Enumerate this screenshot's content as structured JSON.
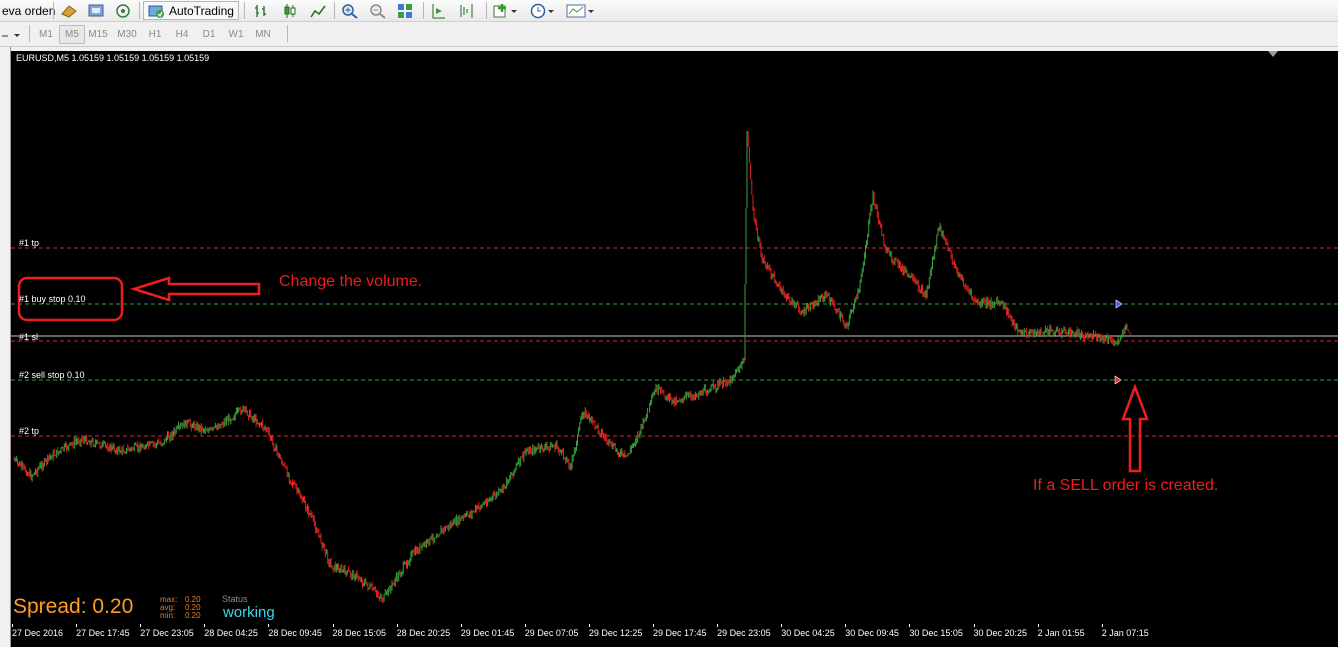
{
  "toolbar": {
    "new_order_label": "eva orden",
    "autotrading_label": "AutoTrading"
  },
  "timeframes": [
    "M1",
    "M5",
    "M15",
    "M30",
    "H1",
    "H4",
    "D1",
    "W1",
    "MN"
  ],
  "active_timeframe": "M5",
  "chart": {
    "symbol_header": "EURUSD,M5  1.05159 1.05159 1.05159 1.05159",
    "levels": [
      {
        "label": "#1 tp",
        "kind": "tp",
        "color": "#d42a2a"
      },
      {
        "label": "#1 buy stop 0.10",
        "kind": "pending",
        "color": "#3a9a3a"
      },
      {
        "label": "#1 sl",
        "kind": "sl",
        "color": "#d42a2a"
      },
      {
        "label": "#2 sell stop 0.10",
        "kind": "pending",
        "color": "#3a9a3a"
      },
      {
        "label": "#2 tp",
        "kind": "tp",
        "color": "#d42a2a"
      }
    ],
    "spread": {
      "text": "Spread: 0.20",
      "max_label": "max:",
      "max_value": "0.20",
      "avg_label": "avg:",
      "avg_value": "0.20",
      "min_label": "min:",
      "min_value": "0.20"
    },
    "status_label": "Status",
    "status_value": "working",
    "annotations": {
      "volume": "Change the volume.",
      "sell": "If a SELL order is created."
    },
    "x_ticks": [
      "27 Dec 2016",
      "27 Dec 17:45",
      "27 Dec 23:05",
      "28 Dec 04:25",
      "28 Dec 09:45",
      "28 Dec 15:05",
      "28 Dec 20:25",
      "29 Dec 01:45",
      "29 Dec 07:05",
      "29 Dec 12:25",
      "29 Dec 17:45",
      "29 Dec 23:05",
      "30 Dec 04:25",
      "30 Dec 09:45",
      "30 Dec 15:05",
      "30 Dec 20:25",
      "2 Jan 01:55",
      "2 Jan 07:15"
    ],
    "colors": {
      "bull": "#3aa03a",
      "bear": "#e02020",
      "annotation": "#ee1e1e"
    }
  }
}
